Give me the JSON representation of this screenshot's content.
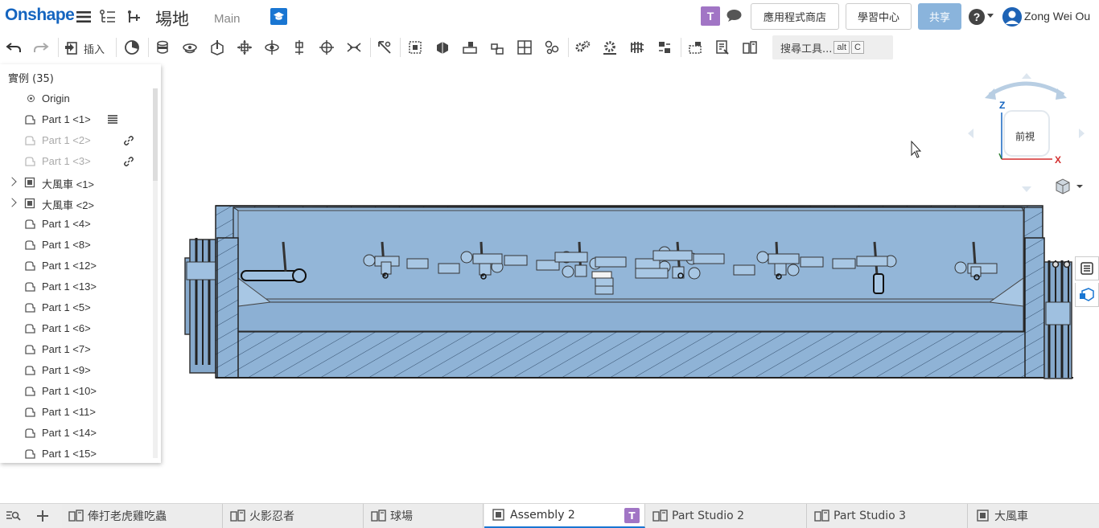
{
  "topbar": {
    "logo": "Onshape",
    "document_title": "場地",
    "workspace": "Main",
    "badge_letter": "T",
    "app_store_label": "應用程式商店",
    "learning_label": "學習中心",
    "share_label": "共享",
    "help_label": "?",
    "user_name": "Zong Wei Ou"
  },
  "toolbar": {
    "insert_label": "插入",
    "search_label": "搜尋工具...",
    "search_kbd1": "alt",
    "search_kbd2": "C"
  },
  "panel": {
    "title": "實例 (35)",
    "items": [
      {
        "label": "Origin",
        "type": "origin",
        "dim": false
      },
      {
        "label": "Part 1 <1>",
        "type": "part",
        "dim": false,
        "extra": "hatch-icon"
      },
      {
        "label": "Part 1 <2>",
        "type": "part",
        "dim": true,
        "extra": "link-icon"
      },
      {
        "label": "Part 1 <3>",
        "type": "part",
        "dim": true,
        "extra": "link-icon"
      },
      {
        "label": "大風車 <1>",
        "type": "assembly",
        "dim": false
      },
      {
        "label": "大風車 <2>",
        "type": "assembly",
        "dim": false
      },
      {
        "label": "Part 1 <4>",
        "type": "part",
        "dim": false
      },
      {
        "label": "Part 1 <8>",
        "type": "part",
        "dim": false
      },
      {
        "label": "Part 1 <12>",
        "type": "part",
        "dim": false
      },
      {
        "label": "Part 1 <13>",
        "type": "part",
        "dim": false
      },
      {
        "label": "Part 1 <5>",
        "type": "part",
        "dim": false
      },
      {
        "label": "Part 1 <6>",
        "type": "part",
        "dim": false
      },
      {
        "label": "Part 1 <7>",
        "type": "part",
        "dim": false
      },
      {
        "label": "Part 1 <9>",
        "type": "part",
        "dim": false
      },
      {
        "label": "Part 1 <10>",
        "type": "part",
        "dim": false
      },
      {
        "label": "Part 1 <11>",
        "type": "part",
        "dim": false
      },
      {
        "label": "Part 1 <14>",
        "type": "part",
        "dim": false
      },
      {
        "label": "Part 1 <15>",
        "type": "part",
        "dim": false
      }
    ]
  },
  "viewcube": {
    "face_label": "前視",
    "axis_z": "Z",
    "axis_x": "X"
  },
  "tabs": [
    {
      "label": "俸打老虎雞吃蟲",
      "active": false
    },
    {
      "label": "火影忍者",
      "active": false
    },
    {
      "label": "球場",
      "active": false
    },
    {
      "label": "Assembly 2",
      "active": true,
      "badge": "T"
    },
    {
      "label": "Part Studio 2",
      "active": false
    },
    {
      "label": "Part Studio 3",
      "active": false
    },
    {
      "label": "大風車",
      "active": false
    }
  ],
  "colors": {
    "brand": "#1565c0",
    "model_fill": "#8fb3d6",
    "model_edge": "#1a1a1a",
    "share_button": "#8ab4dc",
    "badge_purple": "#a175c5"
  }
}
